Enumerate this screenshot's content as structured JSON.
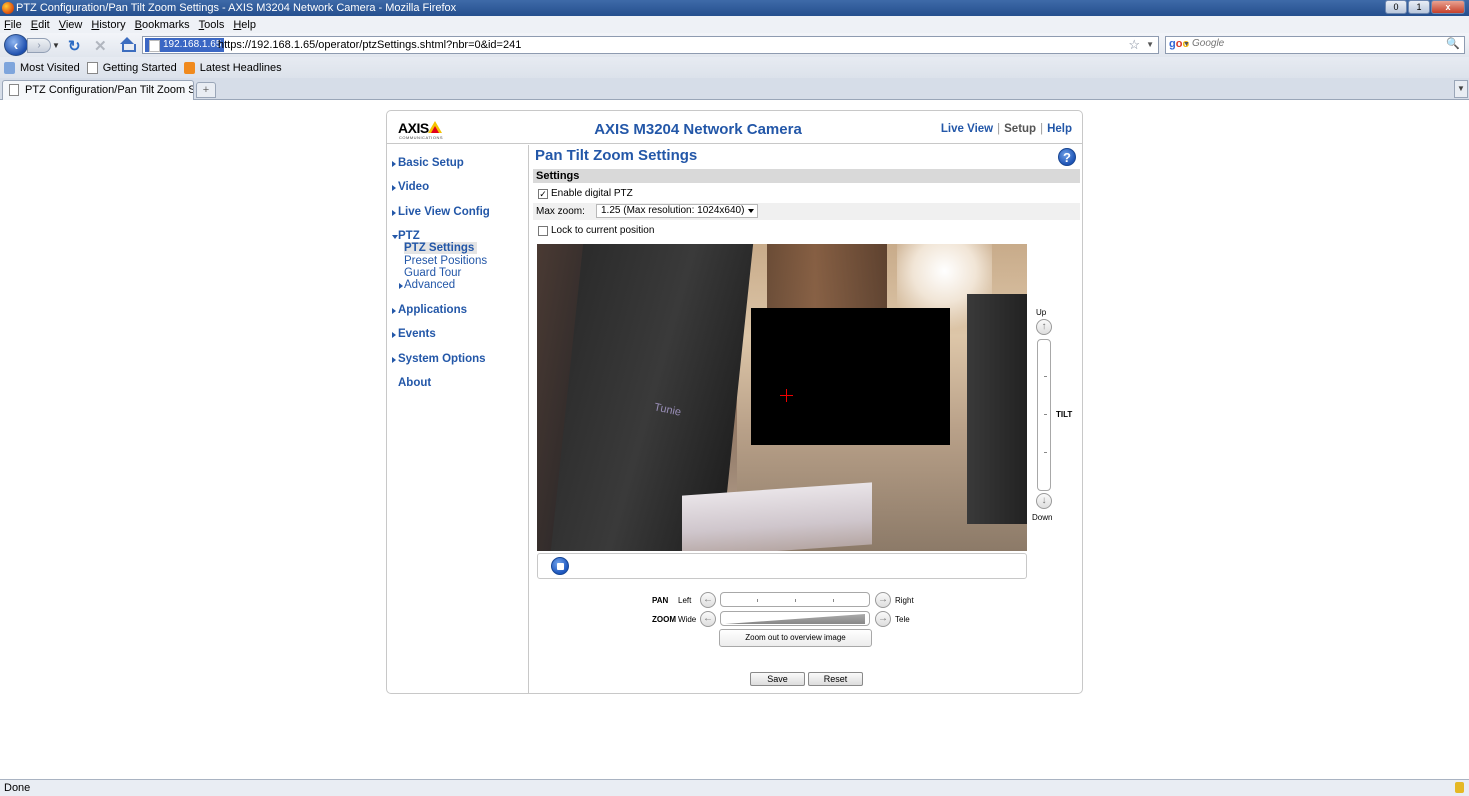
{
  "window": {
    "title": "PTZ Configuration/Pan Tilt Zoom Settings - AXIS M3204 Network Camera - Mozilla Firefox",
    "minimize": "0",
    "maximize": "1",
    "close": "x"
  },
  "menu": [
    "File",
    "Edit",
    "View",
    "History",
    "Bookmarks",
    "Tools",
    "Help"
  ],
  "nav": {
    "site_identity": "192.168.1.65",
    "url": "https://192.168.1.65/operator/ptzSettings.shtml?nbr=0&id=241",
    "search_placeholder": "Google"
  },
  "bookmarks": [
    "Most Visited",
    "Getting Started",
    "Latest Headlines"
  ],
  "tabs": [
    {
      "label": "PTZ Configuration/Pan Tilt Zoom Set..."
    }
  ],
  "new_tab_label": "+",
  "status": "Done",
  "page": {
    "logo": "AXIS",
    "logo_sub": "COMMUNICATIONS",
    "product": "AXIS M3204 Network Camera",
    "toplinks": {
      "live_view": "Live View",
      "setup": "Setup",
      "help": "Help",
      "sep": "|"
    },
    "sidebar": {
      "basic_setup": "Basic Setup",
      "video": "Video",
      "live_view_config": "Live View Config",
      "ptz": "PTZ",
      "ptz_sub": [
        "PTZ Settings",
        "Preset Positions",
        "Guard Tour",
        "Advanced"
      ],
      "applications": "Applications",
      "events": "Events",
      "system_options": "System Options",
      "about": "About"
    },
    "title": "Pan Tilt Zoom Settings",
    "help_icon": "?",
    "section": "Settings",
    "enable_digital_ptz": {
      "label": "Enable digital PTZ",
      "checked": true
    },
    "max_zoom": {
      "label": "Max zoom:",
      "value": "1.25 (Max resolution: 1024x640)"
    },
    "lock_position": {
      "label": "Lock to current position",
      "checked": false
    },
    "video_text": "Tunie",
    "tilt": {
      "name": "TILT",
      "up": "Up",
      "down": "Down"
    },
    "pan": {
      "name": "PAN",
      "left": "Left",
      "right": "Right"
    },
    "zoom": {
      "name": "ZOOM",
      "wide": "Wide",
      "tele": "Tele"
    },
    "overview_button": "Zoom out to overview image",
    "save": "Save",
    "reset": "Reset"
  },
  "colors": {
    "link": "#2357a8",
    "titlebar": "#2f5a98",
    "section": "#d9d9d9"
  }
}
